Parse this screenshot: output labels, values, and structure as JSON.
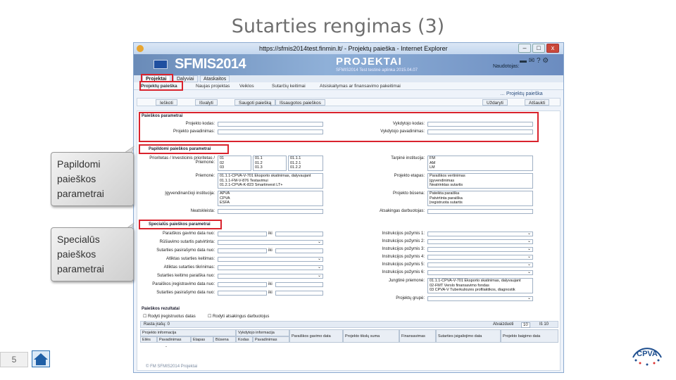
{
  "slide": {
    "title": "Sutarties rengimas (3)",
    "page_number": "5",
    "callout_1": "Papildomi paieškos parametrai",
    "callout_2": "Specialūs paieškos parametrai",
    "logo_text": "CPVA"
  },
  "browser": {
    "title": "https://sfmis2014test.finmin.lt/ - Projektų paieška - Internet Explorer",
    "min": "–",
    "max": "□",
    "close": "x"
  },
  "app": {
    "logo": "SFMIS2014",
    "module": "PROJEKTAI",
    "subtitle": "SFMIS2014 Test testinė aplinka 2015.04.07",
    "user_label": "Naudotojas:"
  },
  "tabs": [
    "Projektai",
    "Dalyviai",
    "Ataskaitos"
  ],
  "subnav": [
    "Projektų paieška",
    "Naujas projektas",
    "Veiklos",
    "Sutarčių keitimai",
    "Atsiskaitymas ar finansavimo pakeitimai"
  ],
  "breadcrumb": "… Projektų paieška",
  "toolbar": {
    "search": "Ieškoti",
    "clear": "Išvalyti",
    "save_search": "Saugoti paiešką",
    "saved_searches": "Išsaugotos paieškos",
    "close": "Uždaryti",
    "cancel": "Atšaukti"
  },
  "search_params": {
    "title": "Paieškos parametrai",
    "project_code": "Projekto kodas:",
    "project_name": "Projekto pavadinimas:",
    "applicant_code": "Vykdytojo kodas:",
    "applicant_name": "Vykdytojo pavadinimas:"
  },
  "extra_params": {
    "title": "Papildomi paieškos parametrai",
    "priority_label": "Prioritetas / Investicinis prioritetas / Priemonė:",
    "priority_col1": [
      "01",
      "02",
      "03"
    ],
    "priority_col2": [
      "01.1",
      "01.2",
      "01.3"
    ],
    "priority_col3": [
      "01.1.1",
      "01.2.1",
      "01.2.2"
    ],
    "measure_label": "Priemonė:",
    "measures": [
      "01.1.1-CPVA-V-701 Eksporto skatinimas, dalyvaujant",
      "01.1.1-FM-V-876 Testavimui",
      "01.2.1-CPVA-K-823 Smartinvest LT+"
    ],
    "institution_label": "Įgyvendinančioji institucija:",
    "institutions": [
      "APVA",
      "CPVA",
      "ESFA"
    ],
    "budget_label": "Neatskleista:",
    "ministry_label": "Tarpinė institucija:",
    "ministries": [
      "FM",
      "AM",
      "LM"
    ],
    "stage_label": "Projekto etapas:",
    "stages": [
      "Paraiškos vertinimas",
      "Įgyvendinimas",
      "Neatrinktas sutartis"
    ],
    "status_label": "Projekto būsena:",
    "statuses": [
      "Pateikta paraiška",
      "Patvirtinta paraiška",
      "Įregistruota sutartis"
    ],
    "form_label": "Atsakingas darbuotojas:"
  },
  "special_params": {
    "title": "Specialūs paieškos parametrai",
    "left_labels": [
      "Paraiškos gavimo data nuo:",
      "Rūšiavimo sutartis patvirtinta:",
      "Sutarties pasirašymo data nuo:",
      "Atliktas sutarties keitimas:",
      "Atliktas sutarties tikrinimas:",
      "Sutarties keitimo paraiška nuo:",
      "Paraiškos įregistravimo data nuo:",
      "Sutarties pasirašymo data nuo:"
    ],
    "to_label": "iki",
    "right_labels": [
      "Instrukcijos požymis 1:",
      "Instrukcijos požymis 2:",
      "Instrukcijos požymis 3:",
      "Instrukcijos požymis 4:",
      "Instrukcijos požymis 5:",
      "Instrukcijos požymis 6:"
    ],
    "joint_label": "Jungtinė priemonė:",
    "joint_items": [
      "01.1.1-CPVA-V-701 Eksporto skatinimas, dalyvaujant",
      "02-FMT Verslo finansavimo fondas",
      "03 CPVA-V Tuberkuliozės profilaktikos, diagnostik"
    ],
    "group_label": "Projektų grupė:"
  },
  "results": {
    "title": "Paieškos rezultatai",
    "check_1": "Rodyti įregistruotus datas",
    "check_2": "Rodyti atsakingus darbuotojus",
    "count": "Rasta įrašų: 0",
    "per_page": "Atvaizduoti",
    "per_page_value": "10",
    "page_info": "Iš 10",
    "group_headers": [
      "Projekto informacija",
      "Vykdytojo informacija"
    ],
    "columns": [
      "Paraiškos gavimo data",
      "Projekto tikslų suma",
      "Finansavimas",
      "Sutarties įsigaliojimo data",
      "Projekto baigimo data"
    ],
    "sub_columns": [
      "Eilės",
      "Pavadinimas",
      "Etapas",
      "Būsena",
      "Kodas",
      "Pavadinimas"
    ],
    "row_dash": "-"
  },
  "footer": "© FM SFMIS2014 Projektai"
}
